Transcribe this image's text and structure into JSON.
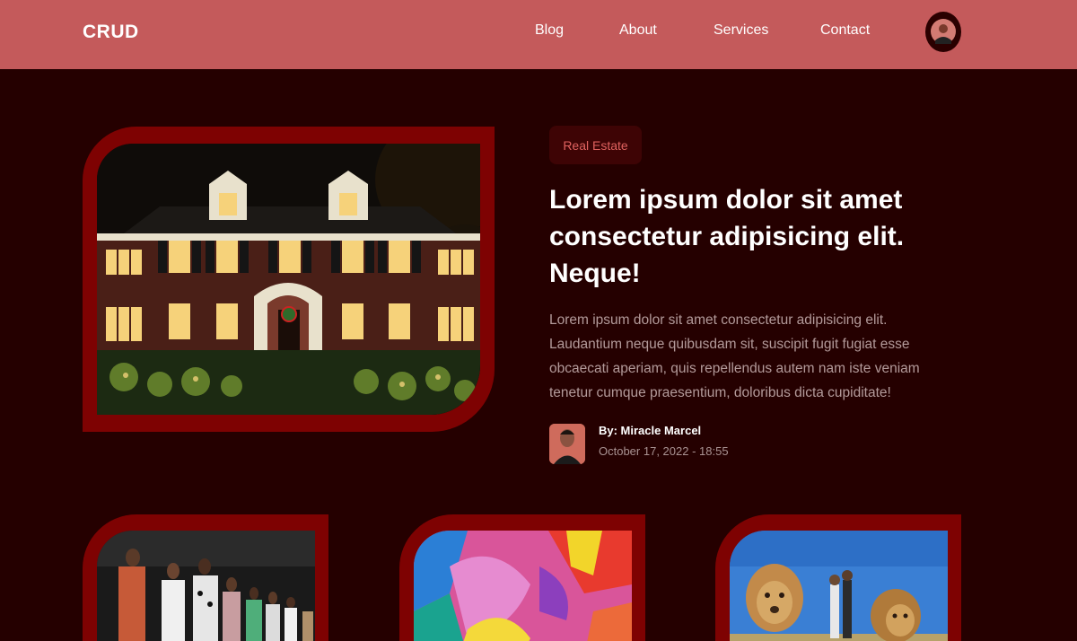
{
  "navbar": {
    "logo": "CRUD",
    "links": [
      "Blog",
      "About",
      "Services",
      "Contact"
    ],
    "avatar_icon": "user-avatar-icon"
  },
  "featured": {
    "category": "Real Estate",
    "title": "Lorem ipsum dolor sit amet consectetur adipisicing elit. Neque!",
    "excerpt": "Lorem ipsum dolor sit amet consectetur adipisicing elit. Laudantium neque quibusdam sit, suscipit fugit fugiat esse obcaecati aperiam, quis repellendus autem nam iste veniam tenetur cumque praesentium, doloribus dicta cupiditate!",
    "author": "By: Miracle Marcel",
    "date": "October 17, 2022 - 18:55",
    "image": "lit-house-night-photo"
  },
  "cards": [
    {
      "image": "fashion-runway-photo"
    },
    {
      "image": "abstract-paint-photo"
    },
    {
      "image": "lions-and-people-photo"
    }
  ],
  "colors": {
    "navbar": "#c45a5b",
    "background": "#250000",
    "frame": "#7e0202",
    "badge_bg": "#3e0405",
    "badge_text": "#e0625f"
  }
}
